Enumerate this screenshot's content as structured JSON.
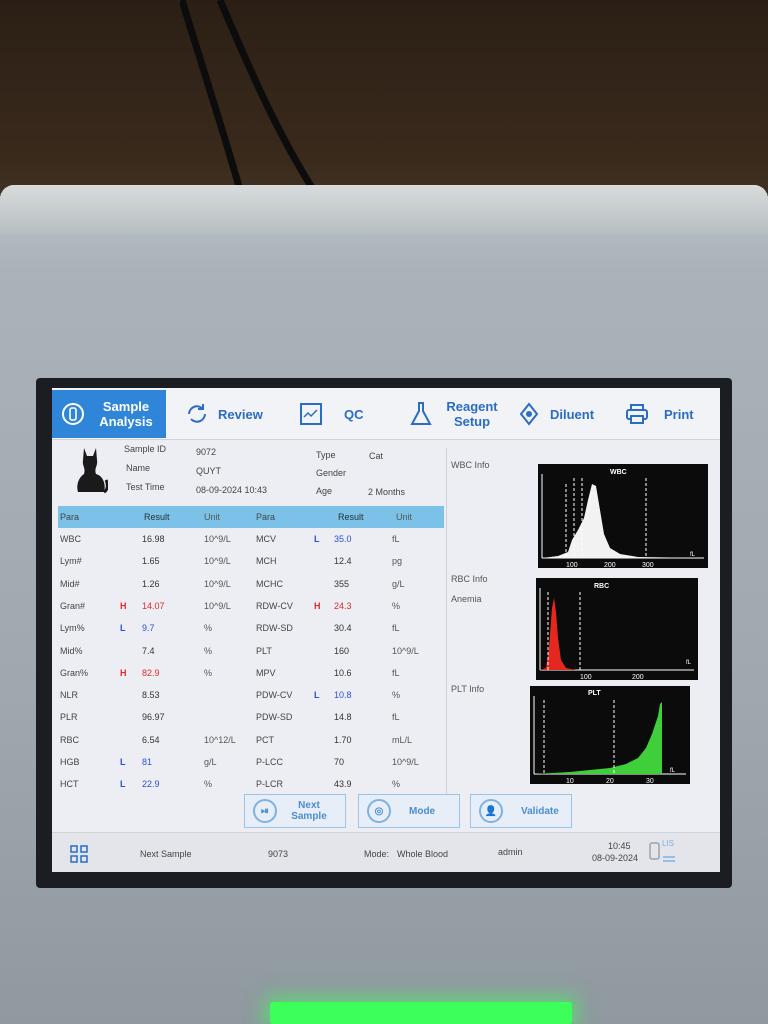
{
  "toolbar": {
    "sample_analysis": "Sample Analysis",
    "review": "Review",
    "qc": "QC",
    "reagent_setup": "Reagent Setup",
    "diluent": "Diluent",
    "print": "Print"
  },
  "patient": {
    "sample_id_label": "Sample ID",
    "sample_id": "9072",
    "name_label": "Name",
    "name": "QUYT",
    "test_time_label": "Test Time",
    "test_time": "08-09-2024 10:43",
    "type_label": "Type",
    "type": "Cat",
    "gender_label": "Gender",
    "age_label": "Age",
    "age": "2 Months"
  },
  "table_header": {
    "para": "Para",
    "result": "Result",
    "unit": "Unit",
    "para2": "Para",
    "result2": "Result",
    "unit2": "Unit"
  },
  "rows": [
    {
      "para": "WBC",
      "flag": "",
      "result": "16.98",
      "unit": "10^9/L",
      "para2": "MCV",
      "flag2": "L",
      "result2": "35.0",
      "unit2": "fL"
    },
    {
      "para": "Lym#",
      "flag": "",
      "result": "1.65",
      "unit": "10^9/L",
      "para2": "MCH",
      "flag2": "",
      "result2": "12.4",
      "unit2": "pg"
    },
    {
      "para": "Mid#",
      "flag": "",
      "result": "1.26",
      "unit": "10^9/L",
      "para2": "MCHC",
      "flag2": "",
      "result2": "355",
      "unit2": "g/L"
    },
    {
      "para": "Gran#",
      "flag": "H",
      "result": "14.07",
      "unit": "10^9/L",
      "para2": "RDW-CV",
      "flag2": "H",
      "result2": "24.3",
      "unit2": "%"
    },
    {
      "para": "Lym%",
      "flag": "L",
      "result": "9.7",
      "unit": "%",
      "para2": "RDW-SD",
      "flag2": "",
      "result2": "30.4",
      "unit2": "fL"
    },
    {
      "para": "Mid%",
      "flag": "",
      "result": "7.4",
      "unit": "%",
      "para2": "PLT",
      "flag2": "",
      "result2": "160",
      "unit2": "10^9/L"
    },
    {
      "para": "Gran%",
      "flag": "H",
      "result": "82.9",
      "unit": "%",
      "para2": "MPV",
      "flag2": "",
      "result2": "10.6",
      "unit2": "fL"
    },
    {
      "para": "NLR",
      "flag": "",
      "result": "8.53",
      "unit": "",
      "para2": "PDW-CV",
      "flag2": "L",
      "result2": "10.8",
      "unit2": "%"
    },
    {
      "para": "PLR",
      "flag": "",
      "result": "96.97",
      "unit": "",
      "para2": "PDW-SD",
      "flag2": "",
      "result2": "14.8",
      "unit2": "fL"
    },
    {
      "para": "RBC",
      "flag": "",
      "result": "6.54",
      "unit": "10^12/L",
      "para2": "PCT",
      "flag2": "",
      "result2": "1.70",
      "unit2": "mL/L"
    },
    {
      "para": "HGB",
      "flag": "L",
      "result": "81",
      "unit": "g/L",
      "para2": "P-LCC",
      "flag2": "",
      "result2": "70",
      "unit2": "10^9/L"
    },
    {
      "para": "HCT",
      "flag": "L",
      "result": "22.9",
      "unit": "%",
      "para2": "P-LCR",
      "flag2": "",
      "result2": "43.9",
      "unit2": "%"
    }
  ],
  "info": {
    "wbc_info": "WBC Info",
    "rbc_info": "RBC Info",
    "rbc_flag": "Anemia",
    "plt_info": "PLT Info"
  },
  "histograms": {
    "wbc": {
      "title": "WBC",
      "ticks": [
        "100",
        "200",
        "300"
      ],
      "unit": "fL",
      "color": "#f2f2f2"
    },
    "rbc": {
      "title": "RBC",
      "ticks": [
        "100",
        "200"
      ],
      "unit": "fL",
      "color": "#e5281f"
    },
    "plt": {
      "title": "PLT",
      "ticks": [
        "10",
        "20",
        "30"
      ],
      "unit": "fL",
      "color": "#3fcf3a"
    }
  },
  "actions": {
    "next_sample": "Next Sample",
    "mode": "Mode",
    "validate": "Validate"
  },
  "status": {
    "next_sample_label": "Next Sample",
    "next_sample_id": "9073",
    "mode_label": "Mode:",
    "mode_value": "Whole Blood",
    "user": "admin",
    "time": "10:45",
    "date": "08-09-2024",
    "lis": "LIS"
  },
  "colors": {
    "accent": "#2f86d8",
    "header": "#7bc1e8",
    "high": "#e02a2a",
    "low": "#2c4fd9"
  }
}
